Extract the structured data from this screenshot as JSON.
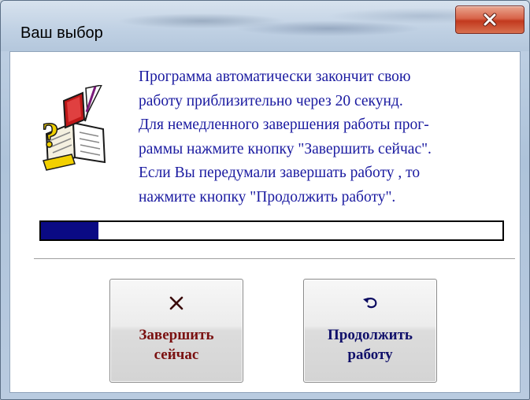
{
  "window": {
    "title": "Ваш выбор"
  },
  "message": {
    "lines": [
      "Программа автоматически закончит свою",
      "работу приблизительно через 20 секунд.",
      "Для немедленного завершения работы прог-",
      "раммы нажмите кнопку \"Завершить сейчас\".",
      "Если Вы передумали завершать работу , то",
      "нажмите кнопку \"Продолжить работу\"."
    ],
    "color": "#1a1aa0"
  },
  "progress": {
    "fraction": 0.125,
    "fill_color": "#0a0a84"
  },
  "buttons": {
    "finish": {
      "line1": "Завершить",
      "line2": "сейчас",
      "icon": "cross-icon",
      "color": "#7a1010"
    },
    "continue": {
      "line1": "Продолжить",
      "line2": "работу",
      "icon": "undo-arrow-icon",
      "color": "#10106a"
    }
  },
  "icons": {
    "app": "book-quill-question-icon",
    "close": "close-icon"
  }
}
